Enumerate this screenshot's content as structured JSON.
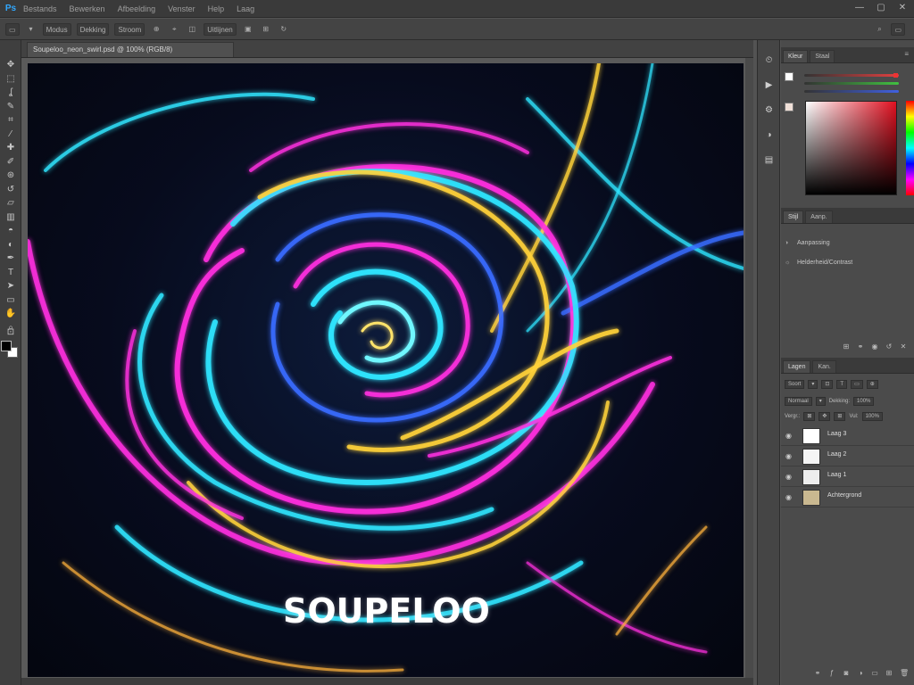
{
  "menubar": {
    "logo": "Ps",
    "items": [
      "Bestands",
      "Bewerken",
      "Afbeelding",
      "Venster",
      "Help",
      "Laag"
    ],
    "window_controls": [
      "—",
      "▢",
      "✕"
    ]
  },
  "options_bar": {
    "items": [
      "▭",
      "▾",
      "Modus",
      "Dekking",
      "Stroom",
      "⊕",
      "⌖",
      "◫",
      "Uitlijnen",
      "▣",
      "⊞",
      "↻"
    ],
    "right_items": [
      "⌕",
      "▭"
    ]
  },
  "document": {
    "tab_title": "Soupeloo_neon_swirl.psd @ 100% (RGB/8)",
    "artwork_text": "SOUPELOO"
  },
  "colors": {
    "app_bg": "#535353",
    "panel_bg": "#4b4b4b",
    "accent": "#31a8ff",
    "neon_cyan": "#2fe6ff",
    "neon_magenta": "#ff2fe0",
    "neon_yellow": "#ffd23a",
    "neon_blue": "#3a6bff"
  },
  "toolbar": {
    "tools": [
      "move-icon",
      "marquee-icon",
      "lasso-icon",
      "quick-select-icon",
      "crop-icon",
      "eyedropper-icon",
      "healing-icon",
      "brush-icon",
      "clone-icon",
      "history-brush-icon",
      "eraser-icon",
      "gradient-icon",
      "blur-icon",
      "dodge-icon",
      "pen-icon",
      "type-icon",
      "path-select-icon",
      "shape-icon",
      "hand-icon",
      "zoom-icon"
    ],
    "glyphs": [
      "✥",
      "⬚",
      "ʆ",
      "✎",
      "⌗",
      "⁄",
      "✚",
      "✐",
      "⊛",
      "↺",
      "▱",
      "▥",
      "◓",
      "◐",
      "✒",
      "T",
      "➤",
      "▭",
      "✋",
      "⌕"
    ],
    "mode_icon": "⊡"
  },
  "icon_strip": {
    "icons": [
      "history-icon",
      "actions-icon",
      "properties-icon",
      "adjustments-icon",
      "libraries-icon"
    ],
    "glyphs": [
      "⏲",
      "▶",
      "⚙",
      "◑",
      "▤"
    ]
  },
  "color_panel": {
    "tabs": [
      "Kleur",
      "Staal"
    ],
    "fg_color": "#ffffff",
    "bg_color": "#f0e0d8"
  },
  "adjust_panel": {
    "tabs": [
      "Stijl",
      "Aanp."
    ],
    "rows": [
      "Aanpassing",
      "Helderheid/Contrast"
    ]
  },
  "layers_panel": {
    "tabs": [
      "Lagen",
      "Kan."
    ],
    "controls_top": [
      "Soort",
      "▾",
      "⊡",
      "T",
      "▭",
      "⊕"
    ],
    "controls_mid": [
      "Normaal",
      "▾",
      "Dekking:",
      "100%"
    ],
    "controls_row": [
      "Vergr.:",
      "⊠",
      "✥",
      "⊞",
      "Vul:",
      "100%"
    ],
    "layers": [
      {
        "name": "Laag 3",
        "thumb": "#ffffff"
      },
      {
        "name": "Laag 2",
        "thumb": "#f5f5f5"
      },
      {
        "name": "Laag 1",
        "thumb": "#eeeeee"
      },
      {
        "name": "Achtergrond",
        "thumb": "#c9b890"
      }
    ],
    "footer_icons": [
      "link-icon",
      "fx-icon",
      "mask-icon",
      "adjustment-layer-icon",
      "group-icon",
      "new-layer-icon",
      "trash-icon"
    ],
    "footer_glyphs": [
      "⚭",
      "ƒ",
      "◙",
      "◑",
      "▭",
      "⊞",
      "🗑"
    ]
  }
}
